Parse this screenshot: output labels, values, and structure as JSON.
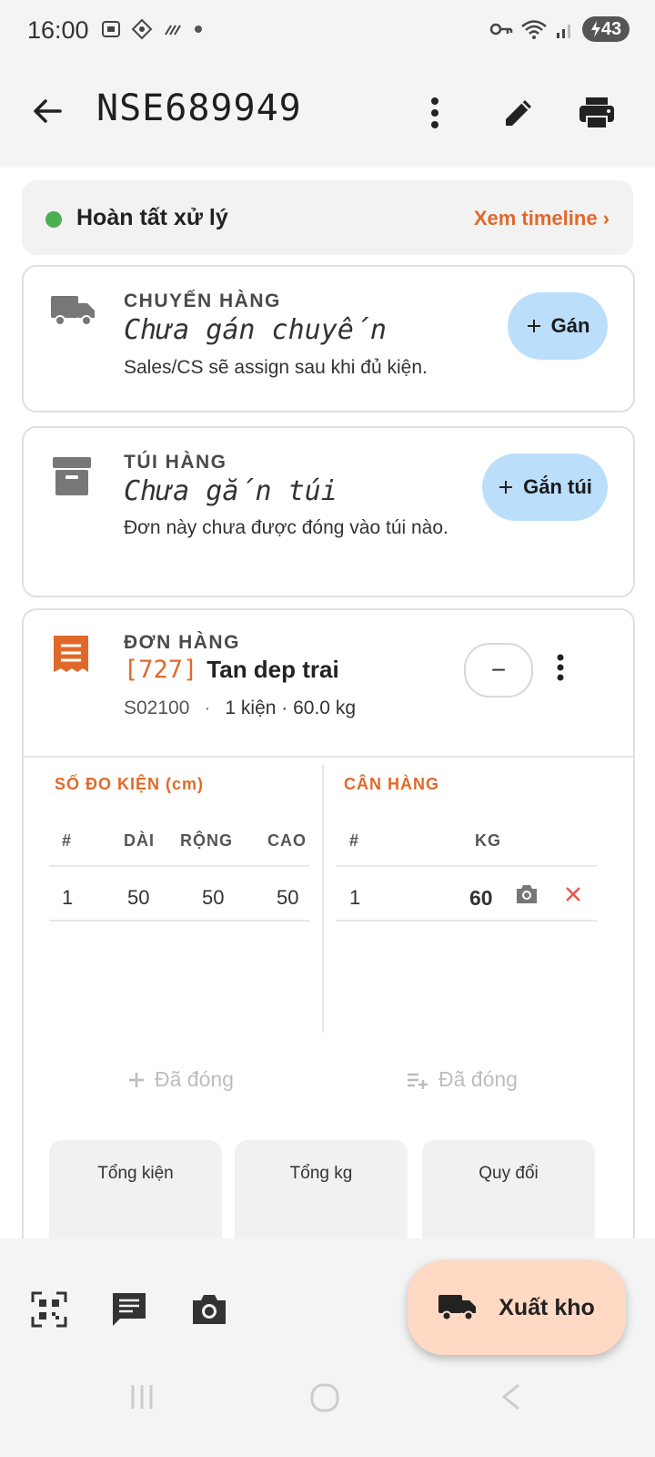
{
  "status_bar": {
    "time": "16:00",
    "battery": "43"
  },
  "app_bar": {
    "title": "NSE689949"
  },
  "status": {
    "text": "Hoàn tất xử lý",
    "link": "Xem timeline ›",
    "color": "#4caf50"
  },
  "shipment": {
    "label": "CHUYẾN HÀNG",
    "value": "Chưa gán chuyến",
    "note": "Sales/CS sẽ assign sau khi đủ kiện.",
    "button": "Gán"
  },
  "bag": {
    "label": "TÚI HÀNG",
    "value": "Chưa gắn túi",
    "note": "Đơn này chưa được đóng vào túi nào.",
    "button": "Gắn túi"
  },
  "order": {
    "label": "ĐƠN HÀNG",
    "code": "[727]",
    "name": "Tan dep trai",
    "ref": "S02100",
    "separator": "·",
    "summary": "1 kiện · 60.0 kg",
    "minus": "−"
  },
  "dimensions": {
    "title": "SỐ ĐO KIỆN (cm)",
    "headers": [
      "#",
      "DÀI",
      "RỘNG",
      "CAO"
    ],
    "rows": [
      [
        "1",
        "50",
        "50",
        "50"
      ]
    ],
    "closed_label": "Đã đóng"
  },
  "weights": {
    "title": "CÂN HÀNG",
    "headers": [
      "#",
      "KG"
    ],
    "rows": [
      [
        "1",
        "60"
      ]
    ],
    "closed_label": "Đã đóng"
  },
  "stats": [
    {
      "label": "Tổng kiện"
    },
    {
      "label": "Tổng kg"
    },
    {
      "label": "Quy đổi"
    }
  ],
  "bottom_bar": {
    "fab_label": "Xuất kho"
  },
  "colors": {
    "accent": "#e0692a",
    "pill": "#bbdefb",
    "fab": "#ffd9c4"
  }
}
